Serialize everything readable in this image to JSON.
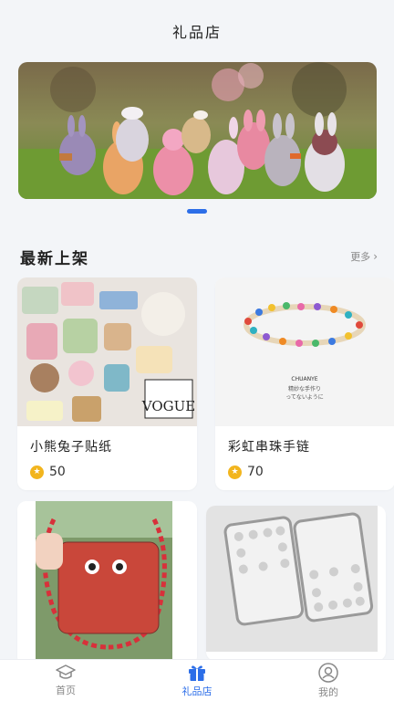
{
  "header": {
    "title": "礼品店"
  },
  "banner": {
    "page_count": 1,
    "active_index": 0
  },
  "section": {
    "title": "最新上架",
    "more_label": "更多"
  },
  "products": [
    {
      "name": "小熊兔子贴纸",
      "points": "50"
    },
    {
      "name": "彩虹串珠手链",
      "points": "70"
    },
    {
      "name": "",
      "points": ""
    },
    {
      "name": "",
      "points": ""
    }
  ],
  "bracelet_print": {
    "brand": "CHUANYE",
    "line1": "精妙な手作り",
    "line2": "ってないように"
  },
  "sticker_print": {
    "vogue": "VOGUE"
  },
  "tabbar": [
    {
      "label": "首页",
      "icon": "graduation-cap-icon"
    },
    {
      "label": "礼品店",
      "icon": "gift-icon",
      "active": true
    },
    {
      "label": "我的",
      "icon": "user-icon"
    }
  ],
  "colors": {
    "accent": "#2c6ee8",
    "coin": "#f2b51e",
    "background": "#f3f5f8"
  }
}
